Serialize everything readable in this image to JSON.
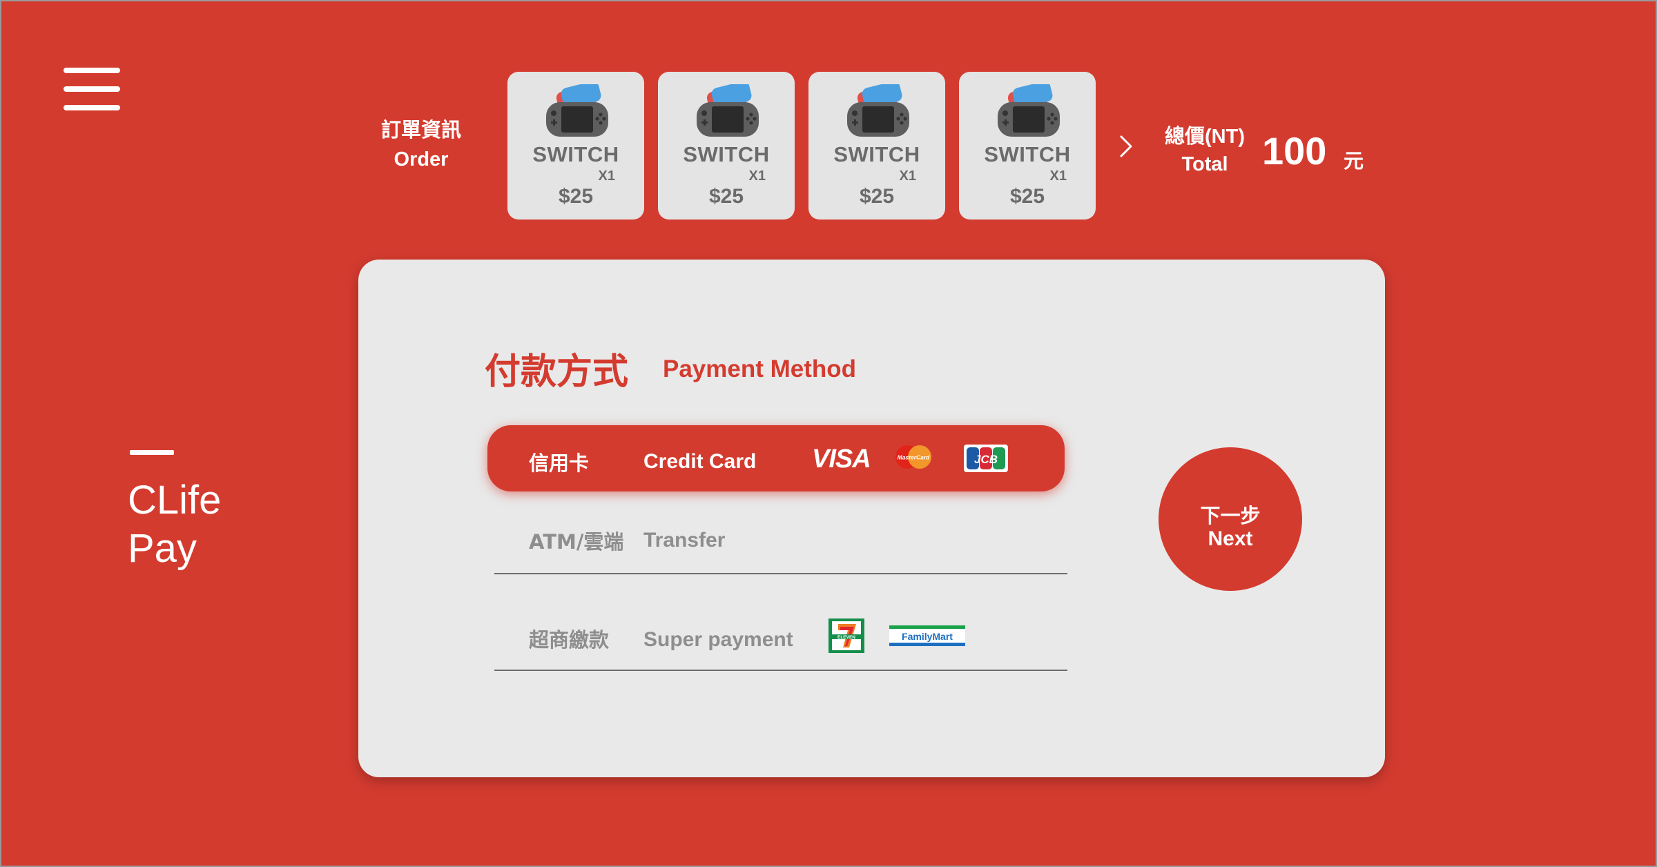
{
  "brand": {
    "line1": "CLife",
    "line2": "Pay"
  },
  "order": {
    "label_zh": "訂單資訊",
    "label_en": "Order",
    "items": [
      {
        "name": "SWITCH",
        "qty": "X1",
        "price": "$25",
        "icon": "game-console-icon"
      },
      {
        "name": "SWITCH",
        "qty": "X1",
        "price": "$25",
        "icon": "game-console-icon"
      },
      {
        "name": "SWITCH",
        "qty": "X1",
        "price": "$25",
        "icon": "game-console-icon"
      },
      {
        "name": "SWITCH",
        "qty": "X1",
        "price": "$25",
        "icon": "game-console-icon"
      }
    ]
  },
  "total": {
    "label_zh": "總價(NT)",
    "label_en": "Total",
    "amount": "100",
    "currency": "元"
  },
  "payment": {
    "title_zh": "付款方式",
    "title_en": "Payment Method",
    "options": [
      {
        "zh": "信用卡",
        "en": "Credit Card",
        "selected": true,
        "logos": [
          "VISA",
          "MasterCard",
          "JCB"
        ]
      },
      {
        "zh": "ATM/雲端",
        "en": "Transfer",
        "selected": false
      },
      {
        "zh": "超商繳款",
        "en": "Super payment",
        "selected": false,
        "logos": [
          "ELEVEN",
          "FamilyMart"
        ]
      }
    ]
  },
  "next": {
    "zh": "下一步",
    "en": "Next"
  },
  "colors": {
    "brand_red": "#d43b2f",
    "card_bg": "#e9e9e9",
    "tile_bg": "#e4e4e4",
    "muted_text": "#8e8e8e"
  }
}
